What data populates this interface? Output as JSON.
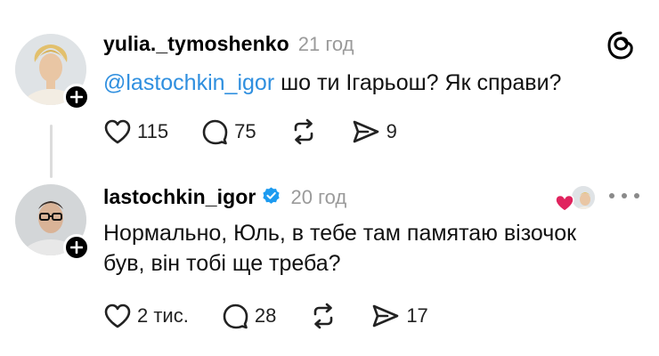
{
  "post1": {
    "username": "yulia._tymoshenko",
    "time": "21 год",
    "mention": "@lastochkin_igor",
    "text": " шо ти Ігарьош? Як справи?",
    "likes": "115",
    "replies": "75",
    "shares": "9"
  },
  "post2": {
    "username": "lastochkin_igor",
    "time": "20 год",
    "text_line1": "Нормально, Юль, в тебе там памятаю візочок",
    "text_line2": "був, він тобі ще треба?",
    "likes": "2 тис.",
    "replies": "28",
    "shares": "17"
  },
  "icons": {
    "threads_logo": "threads-logo-icon",
    "heart": "heart-icon",
    "reply": "reply-bubble-icon",
    "repost": "repost-icon",
    "share": "send-icon",
    "verified": "verified-badge-icon",
    "more": "more-icon",
    "follow": "plus-icon"
  },
  "colors": {
    "mention": "#2f8fdf",
    "verified": "#1d9bf0",
    "liked_heart": "#e0245e",
    "muted": "#9a9a9a"
  }
}
